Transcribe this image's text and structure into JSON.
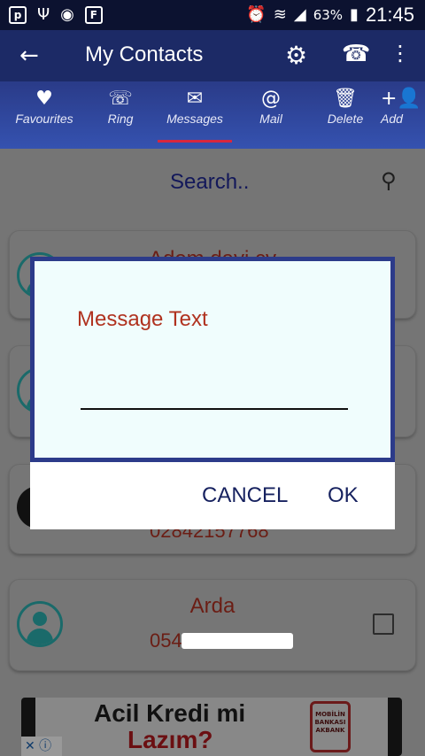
{
  "status_bar": {
    "battery": "63%",
    "time": "21:45",
    "left_icon_letter": "p",
    "left_icon_letter2": "F"
  },
  "app_bar": {
    "title": "My Contacts"
  },
  "tabs": [
    {
      "label": "Favourites",
      "icon": "heart-folder-icon"
    },
    {
      "label": "Ring",
      "icon": "phone-icon"
    },
    {
      "label": "Messages",
      "icon": "envelope-icon"
    },
    {
      "label": "Mail",
      "icon": "address-book-icon"
    },
    {
      "label": "Delete",
      "icon": "trash-icon"
    },
    {
      "label": "Add",
      "icon": "add-person-icon"
    }
  ],
  "search": {
    "placeholder": "Search.."
  },
  "contacts": [
    {
      "name": "Adem dayi cv",
      "phone": ""
    },
    {
      "name": "",
      "phone": ""
    },
    {
      "name": "",
      "phone": "02842157768"
    },
    {
      "name": "Arda",
      "phone": "054"
    }
  ],
  "ad": {
    "line1": "Acil Kredi mi",
    "line2": "Lazım?",
    "logo_text": "MOBİLİN BANKASI AKBANK"
  },
  "dialog": {
    "title": "Message Text",
    "input_value": "",
    "cancel_label": "CANCEL",
    "ok_label": "OK"
  }
}
